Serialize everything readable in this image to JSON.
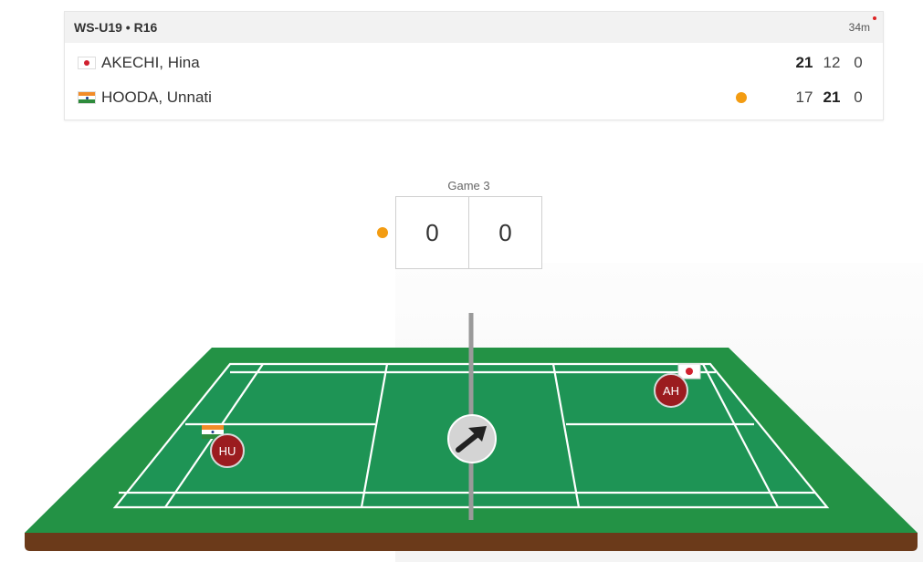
{
  "match": {
    "title": "WS-U19 • R16",
    "duration": "34m",
    "players": [
      {
        "name": "AKECHI, Hina",
        "flag": "japan-flag-icon",
        "scores": [
          "21",
          "12",
          "0"
        ],
        "serving": false
      },
      {
        "name": "HOODA, Unnati",
        "flag": "india-flag-icon",
        "scores": [
          "17",
          "21",
          "0"
        ],
        "serving": true
      }
    ]
  },
  "game": {
    "label": "Game 3",
    "left_score": "0",
    "right_score": "0",
    "serve_indicator_color": "#f39c12"
  },
  "court": {
    "court_color": "#1e9455",
    "surround_color": "#239245",
    "base_color": "#6b3a1a",
    "players": [
      {
        "initials": "HU",
        "flag": "india-flag-icon"
      },
      {
        "initials": "AH",
        "flag": "japan-flag-icon"
      }
    ],
    "direction_icon": "arrow-up-right-icon"
  },
  "colors": {
    "player_marker": "#9b1c1f",
    "serve_dot": "#f39c12",
    "live_dot": "#dd2222"
  }
}
